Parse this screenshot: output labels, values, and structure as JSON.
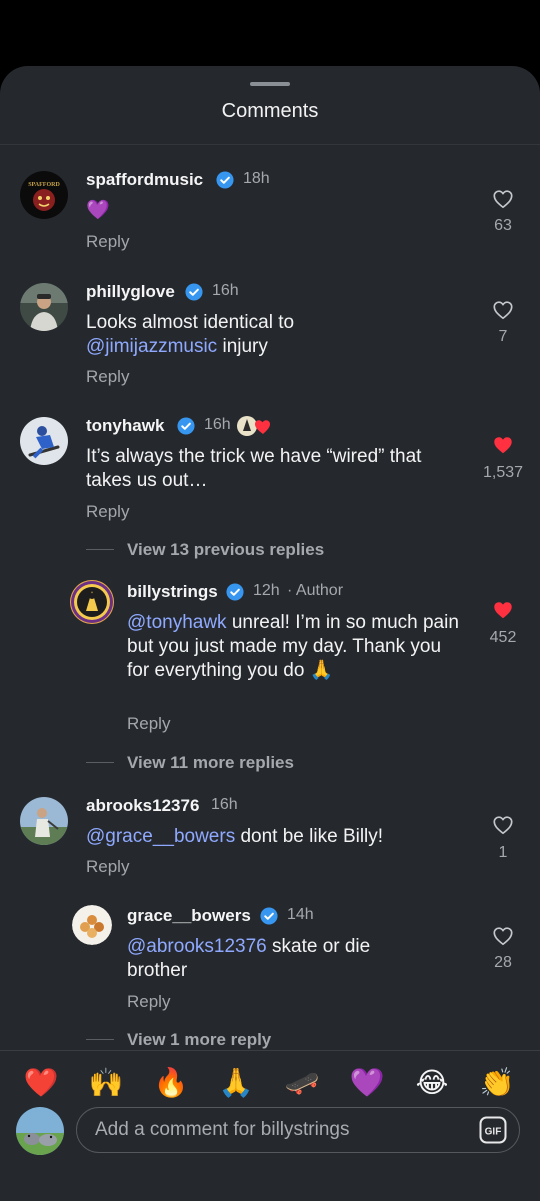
{
  "sheet": {
    "title": "Comments"
  },
  "comments": [
    {
      "username": "spaffordmusic",
      "time": "18h",
      "text": "💜",
      "reply": "Reply",
      "likes": "63",
      "liked": false
    },
    {
      "username": "phillyglove",
      "time": "16h",
      "text_before": "Looks almost identical to",
      "mention": "@jimijazzmusic",
      "text_after": "injury",
      "reply": "Reply",
      "likes": "7",
      "liked": false
    },
    {
      "username": "tonyhawk",
      "time": "16h",
      "text": "It’s always the trick we have “wired” that takes us out…",
      "reply": "Reply",
      "likes": "1,537",
      "liked": true,
      "view_replies": "View 13 previous replies",
      "replies": [
        {
          "username": "billystrings",
          "time": "12h",
          "tag": "· Author",
          "mention": "@tonyhawk",
          "text": "unreal! I’m in so much pain but you just made my day. Thank you for everything you do 🙏",
          "reply": "Reply",
          "likes": "452",
          "liked": true
        }
      ],
      "view_more": "View 11 more replies"
    },
    {
      "username": "abrooks12376",
      "time": "16h",
      "mention": "@grace__bowers",
      "text": "dont be like Billy!",
      "reply": "Reply",
      "likes": "1",
      "liked": false,
      "replies": [
        {
          "username": "grace__bowers",
          "time": "14h",
          "mention": "@abrooks12376",
          "text": "skate or die brother",
          "reply": "Reply",
          "likes": "28",
          "liked": false
        }
      ],
      "view_more": "View 1 more reply"
    }
  ],
  "quick_reactions": [
    "❤️",
    "🙌",
    "🔥",
    "🙏",
    "🛹",
    "💜",
    "😂",
    "👏"
  ],
  "composer": {
    "placeholder": "Add a comment for billystrings",
    "gif_label": "GIF"
  },
  "colors": {
    "background": "#25292e",
    "verified": "#3797f0",
    "like_active": "#ff3040",
    "mention": "#8fa9ff"
  }
}
